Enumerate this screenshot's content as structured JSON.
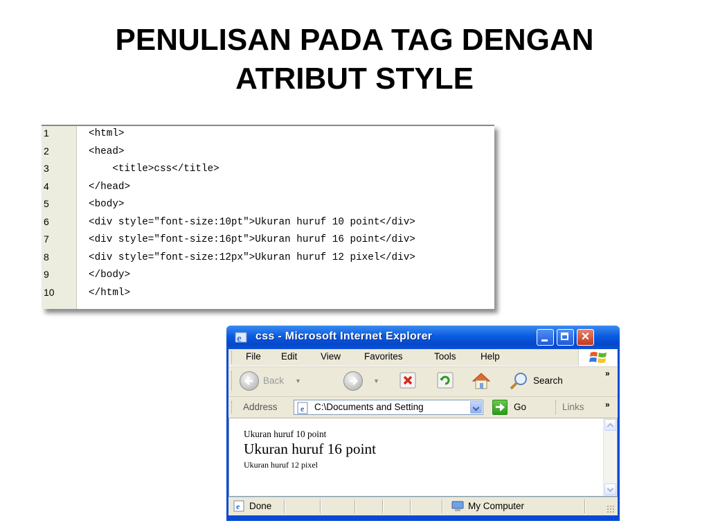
{
  "slide": {
    "title_line1": "PENULISAN PADA TAG DENGAN",
    "title_line2": "ATRIBUT STYLE"
  },
  "code_listing": {
    "lines": [
      {
        "num": "1",
        "code": "<html>"
      },
      {
        "num": "2",
        "code": "<head>"
      },
      {
        "num": "3",
        "code": "    <title>css</title>"
      },
      {
        "num": "4",
        "code": "</head>"
      },
      {
        "num": "5",
        "code": "<body>"
      },
      {
        "num": "6",
        "code": "<div style=\"font-size:10pt\">Ukuran huruf 10 point</div>"
      },
      {
        "num": "7",
        "code": "<div style=\"font-size:16pt\">Ukuran huruf 16 point</div>"
      },
      {
        "num": "8",
        "code": "<div style=\"font-size:12px\">Ukuran huruf 12 pixel</div>"
      },
      {
        "num": "9",
        "code": "</body>"
      },
      {
        "num": "10",
        "code": "</html>"
      }
    ]
  },
  "ie_window": {
    "title": "css - Microsoft Internet Explorer",
    "menu": [
      "File",
      "Edit",
      "View",
      "Favorites",
      "Tools",
      "Help"
    ],
    "toolbar": {
      "back_label": "Back",
      "search_label": "Search",
      "overflow": "»"
    },
    "address": {
      "label": "Address",
      "value": "C:\\Documents and Setting",
      "go_label": "Go",
      "links_label": "Links",
      "overflow": "»"
    },
    "content": {
      "line1": "Ukuran huruf 10 point",
      "line2": "Ukuran huruf 16 point",
      "line3": "Ukuran huruf 12 pixel"
    },
    "status": {
      "done": "Done",
      "zone": "My Computer"
    },
    "icons": {
      "title": "ie-icon",
      "back": "back-arrow-icon",
      "forward": "forward-arrow-icon",
      "stop": "stop-icon",
      "refresh": "refresh-icon",
      "home": "home-icon",
      "search": "search-magnifier-icon",
      "go": "go-arrow-icon",
      "page": "page-icon",
      "computer": "computer-icon"
    }
  },
  "colors": {
    "xp_blue": "#0a49d6",
    "chrome": "#ece9d8",
    "close_red": "#c2391a"
  }
}
